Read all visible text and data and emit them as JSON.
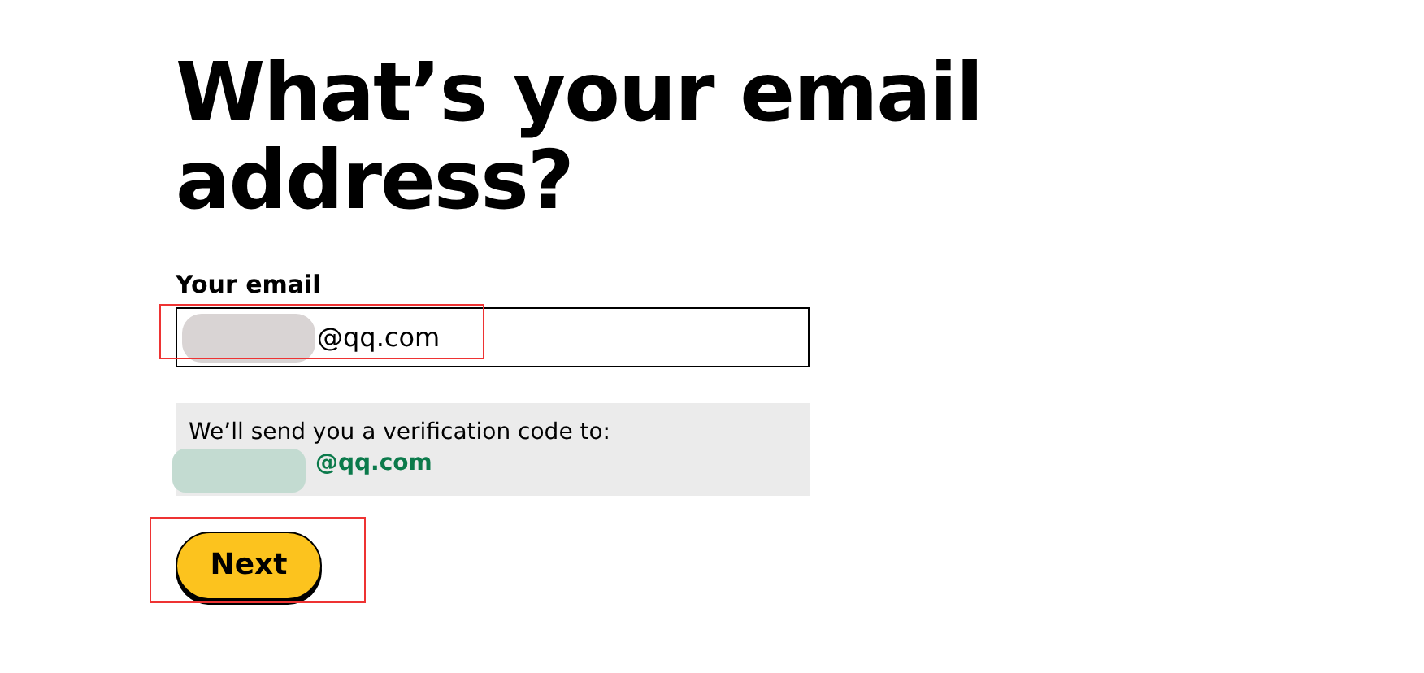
{
  "heading": "What’s your email address?",
  "email_field": {
    "label": "Your email",
    "value": "@qq.com"
  },
  "notice": {
    "text": "We’ll send you a verification code to:",
    "email": "@qq.com"
  },
  "next_button": {
    "label": "Next"
  }
}
